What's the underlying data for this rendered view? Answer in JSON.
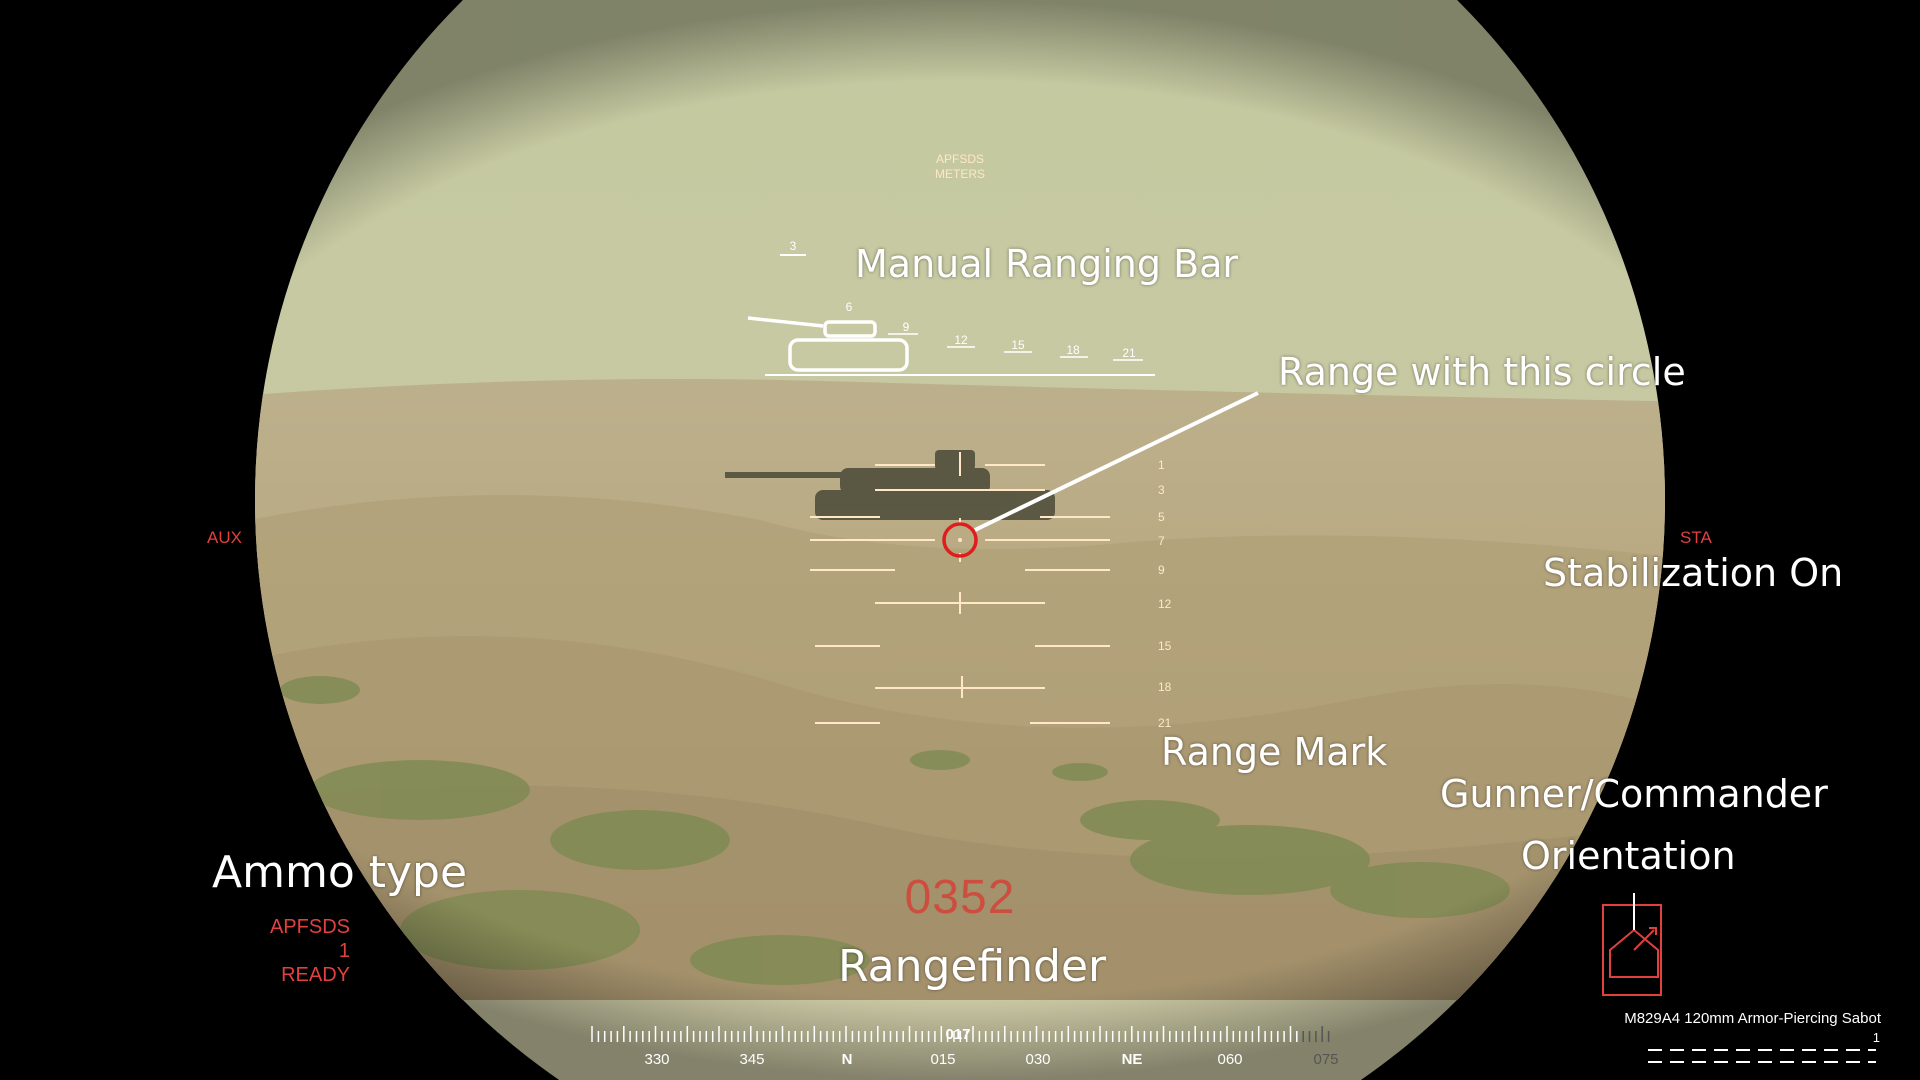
{
  "sight": {
    "ammo_header": "APFSDS",
    "units_header": "METERS",
    "left_mode": "AUX",
    "right_mode": "STA",
    "range_readout": "0352",
    "ammo_type": "APFSDS",
    "ammo_loaded": "1",
    "ammo_status": "READY"
  },
  "ranging_bar": {
    "ticks": [
      "3",
      "6",
      "9",
      "12",
      "15",
      "18",
      "21"
    ]
  },
  "reticle": {
    "range_marks": [
      "1",
      "3",
      "5",
      "7",
      "9",
      "12",
      "15",
      "18",
      "21"
    ]
  },
  "annotations": {
    "manual_ranging_bar": "Manual Ranging Bar",
    "range_circle": "Range with this circle",
    "stabilization": "Stabilization On",
    "range_mark": "Range Mark",
    "orientation_line1": "Gunner/Commander",
    "orientation_line2": "Orientation",
    "ammo_type": "Ammo type",
    "rangefinder": "Rangefinder"
  },
  "compass": {
    "heading": "017",
    "labels": [
      "330",
      "345",
      "N",
      "015",
      "030",
      "NE",
      "060",
      "075"
    ]
  },
  "ammo_panel": {
    "name": "M829A4 120mm Armor-Piercing Sabot",
    "count": "1"
  },
  "colors": {
    "hud_red": "#e0413f",
    "reticle": "#ffe7c8",
    "sky": "#c9c9a2",
    "sand": "#b3a47c"
  }
}
